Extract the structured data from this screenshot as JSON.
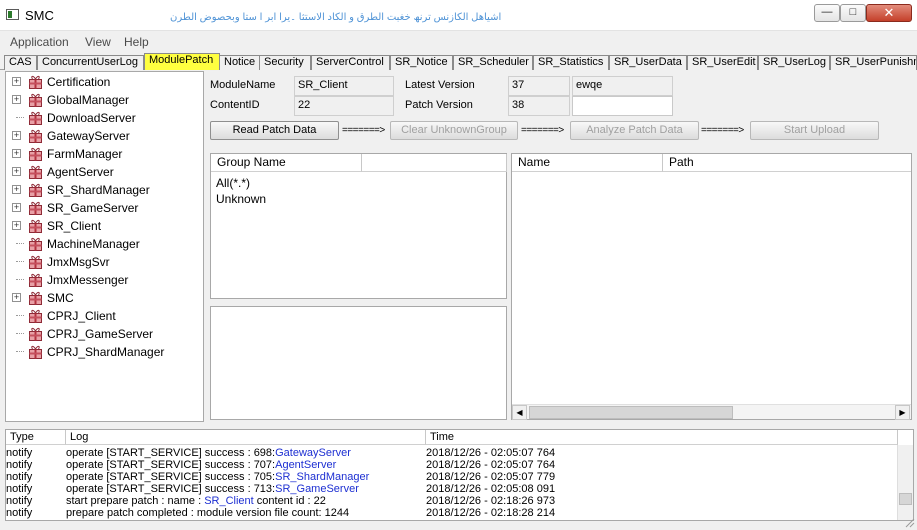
{
  "window": {
    "title": "SMC",
    "banner": "اشیاھل الکازنس ترنھ خغبت الطرق و الکاد الاستثا ۔یرا ابر ا ستا وبحصوض الطرن"
  },
  "menu": [
    "Application",
    "View",
    "Help"
  ],
  "tabs": [
    "CAS",
    "ConcurrentUserLog",
    "ModulePatch",
    "Notice",
    "Security",
    "ServerControl",
    "SR_Notice",
    "SR_Scheduler",
    "SR_Statistics",
    "SR_UserData",
    "SR_UserEdit",
    "SR_UserLog",
    "SR_UserPunishment"
  ],
  "active_tab": "ModulePatch",
  "tree": [
    {
      "label": "Certification",
      "expandable": true
    },
    {
      "label": "GlobalManager",
      "expandable": true
    },
    {
      "label": "DownloadServer",
      "expandable": false
    },
    {
      "label": "GatewayServer",
      "expandable": true
    },
    {
      "label": "FarmManager",
      "expandable": true
    },
    {
      "label": "AgentServer",
      "expandable": true
    },
    {
      "label": "SR_ShardManager",
      "expandable": true
    },
    {
      "label": "SR_GameServer",
      "expandable": true
    },
    {
      "label": "SR_Client",
      "expandable": true
    },
    {
      "label": "MachineManager",
      "expandable": false
    },
    {
      "label": "JmxMsgSvr",
      "expandable": false
    },
    {
      "label": "JmxMessenger",
      "expandable": false
    },
    {
      "label": "SMC",
      "expandable": true
    },
    {
      "label": "CPRJ_Client",
      "expandable": false
    },
    {
      "label": "CPRJ_GameServer",
      "expandable": false
    },
    {
      "label": "CPRJ_ShardManager",
      "expandable": false
    }
  ],
  "module": {
    "module_name_label": "ModuleName",
    "module_name_value": "SR_Client",
    "content_id_label": "ContentID",
    "content_id_value": "22",
    "latest_version_label": "Latest Version",
    "latest_version_value": "37",
    "latest_version_note": "ewqe",
    "patch_version_label": "Patch Version",
    "patch_version_value": "38",
    "patch_version_note": ""
  },
  "actions": {
    "read": "Read Patch Data",
    "clear": "Clear UnknownGroup",
    "analyze": "Analyze Patch Data",
    "upload": "Start Upload",
    "arrow": "=======>"
  },
  "group_list": {
    "headers": [
      "Group Name",
      ""
    ],
    "items": [
      "All(*.*)",
      "Unknown"
    ]
  },
  "file_list": {
    "headers": [
      "Name",
      "Path"
    ]
  },
  "log": {
    "headers": [
      "Type",
      "Log",
      "Time"
    ],
    "rows": [
      {
        "type": "notify",
        "text": "operate [START_SERVICE] success : 698:",
        "target": "GatewayServer",
        "suffix": "",
        "time": "2018/12/26 - 02:05:07 764"
      },
      {
        "type": "notify",
        "text": "operate [START_SERVICE] success : 707:",
        "target": "AgentServer",
        "suffix": "",
        "time": "2018/12/26 - 02:05:07 764"
      },
      {
        "type": "notify",
        "text": "operate [START_SERVICE] success : 705:",
        "target": "SR_ShardManager",
        "suffix": "",
        "time": "2018/12/26 - 02:05:07 779"
      },
      {
        "type": "notify",
        "text": "operate [START_SERVICE] success : 713:",
        "target": "SR_GameServer",
        "suffix": "",
        "time": "2018/12/26 - 02:05:08 091"
      },
      {
        "type": "notify",
        "text": "start prepare patch : name : ",
        "target": "SR_Client",
        "suffix": " content id : 22",
        "time": "2018/12/26 - 02:18:26 973"
      },
      {
        "type": "notify",
        "text": "prepare patch completed : module version file count: 1244",
        "target": "",
        "suffix": "",
        "time": "2018/12/26 - 02:18:28 214"
      }
    ]
  }
}
